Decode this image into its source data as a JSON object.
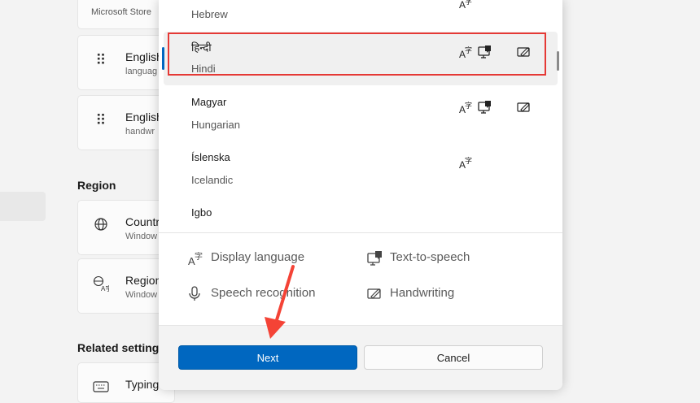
{
  "background": {
    "top_card_sub": "Microsoft Store",
    "cards": [
      {
        "title": "English",
        "sub": "languag",
        "icon": "drag-handle-icon"
      },
      {
        "title": "English",
        "sub": "handwr",
        "icon": "drag-handle-icon"
      },
      {
        "title": "Countr",
        "sub": "Window",
        "icon": "globe-icon"
      },
      {
        "title": "Region",
        "sub": "Window",
        "icon": "region-format-icon"
      },
      {
        "title": "Typing",
        "sub": "",
        "icon": "keyboard-icon"
      }
    ],
    "region_label": "Region",
    "related_label": "Related settings"
  },
  "dialog": {
    "languages": [
      {
        "native": "",
        "english": "Hebrew",
        "features": [
          "display-language"
        ]
      },
      {
        "native": "हिन्दी",
        "english": "Hindi",
        "features": [
          "display-language",
          "text-to-speech",
          "handwriting"
        ]
      },
      {
        "native": "Magyar",
        "english": "Hungarian",
        "features": [
          "display-language",
          "text-to-speech",
          "handwriting"
        ]
      },
      {
        "native": "Íslenska",
        "english": "Icelandic",
        "features": [
          "display-language"
        ]
      },
      {
        "native": "Igbo",
        "english": "",
        "features": []
      }
    ],
    "legend": {
      "display_language": "Display language",
      "text_to_speech": "Text-to-speech",
      "speech_recognition": "Speech recognition",
      "handwriting": "Handwriting"
    },
    "buttons": {
      "next": "Next",
      "cancel": "Cancel"
    }
  },
  "colors": {
    "accent": "#0067c0",
    "highlight": "#e53935",
    "annotation_arrow": "#f44336"
  }
}
